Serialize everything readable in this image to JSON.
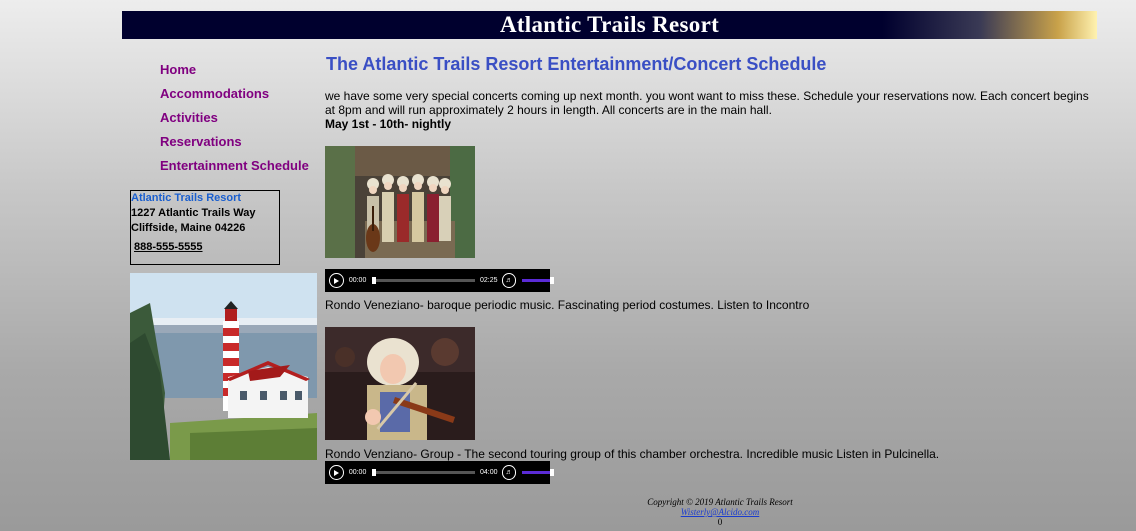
{
  "banner": {
    "title": "Atlantic Trails Resort"
  },
  "nav": [
    {
      "label": "Home"
    },
    {
      "label": "Accommodations"
    },
    {
      "label": "Activities"
    },
    {
      "label": "Reservations"
    },
    {
      "label": "Entertainment Schedule"
    }
  ],
  "address": {
    "name": "Atlantic Trails Resort",
    "street": "1227 Atlantic Trails Way",
    "city": "Cliffside, Maine 04226",
    "phone": "888-555-5555"
  },
  "main": {
    "heading": "The Atlantic Trails Resort Entertainment/Concert Schedule",
    "intro": "we have some very special concerts coming up next month. you wont want to miss these. Schedule your reservations now. Each concert begins at 8pm and will run approximately 2 hours in length. All concerts are in the main hall.",
    "dates": "May 1st - 10th- nightly",
    "concerts": [
      {
        "player": {
          "current": "00:00",
          "duration": "02:25",
          "progress": 0,
          "volume": 1.0
        },
        "caption": "Rondo Veneziano- baroque periodic music. Fascinating period costumes. Listen to Incontro"
      },
      {
        "player": {
          "current": "00:00",
          "duration": "04:00",
          "progress": 0,
          "volume": 1.0
        },
        "caption": "Rondo Venziano- Group - The second touring group of this chamber orchestra. Incredible music Listen in Pulcinella."
      }
    ]
  },
  "footer": {
    "copyright": "Copyright © 2019 Atlantic Trails Resort",
    "email": "Wisterly@Alcido.com",
    "counter": "0"
  },
  "colors": {
    "banner_bg": "#00002e",
    "nav_link": "#800080",
    "heading": "#3a4fc4"
  }
}
